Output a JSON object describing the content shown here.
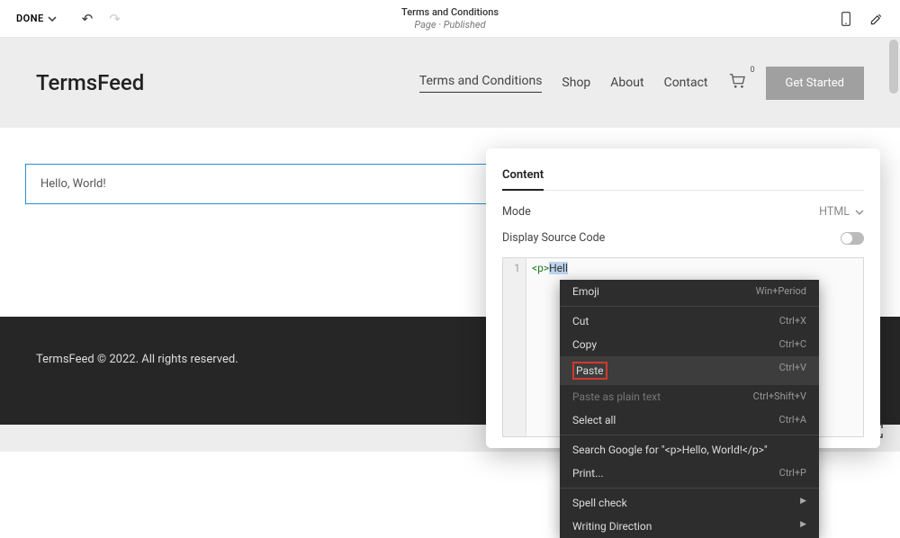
{
  "toolbar": {
    "done": "DONE",
    "title": "Terms and Conditions",
    "subtitle": "Page · Published"
  },
  "site": {
    "brand": "TermsFeed",
    "nav": {
      "terms": "Terms and Conditions",
      "shop": "Shop",
      "about": "About",
      "contact": "Contact",
      "cart_count": "0",
      "cta": "Get Started"
    },
    "body_text": "Hello, World!",
    "footer": "TermsFeed © 2022. All rights reserved."
  },
  "panel": {
    "tab": "Content",
    "mode_label": "Mode",
    "mode_value": "HTML",
    "display_src": "Display Source Code",
    "code_line": "1",
    "code_open": "<p>",
    "code_text": "Hell"
  },
  "ctx": {
    "emoji": "Emoji",
    "emoji_k": "Win+Period",
    "cut": "Cut",
    "cut_k": "Ctrl+X",
    "copy": "Copy",
    "copy_k": "Ctrl+C",
    "paste": "Paste",
    "paste_k": "Ctrl+V",
    "paste_plain": "Paste as plain text",
    "paste_plain_k": "Ctrl+Shift+V",
    "select_all": "Select all",
    "select_all_k": "Ctrl+A",
    "search": "Search Google for \"<p>Hello, World!</p>\"",
    "print": "Print...",
    "print_k": "Ctrl+P",
    "spell": "Spell check",
    "writing": "Writing Direction"
  }
}
